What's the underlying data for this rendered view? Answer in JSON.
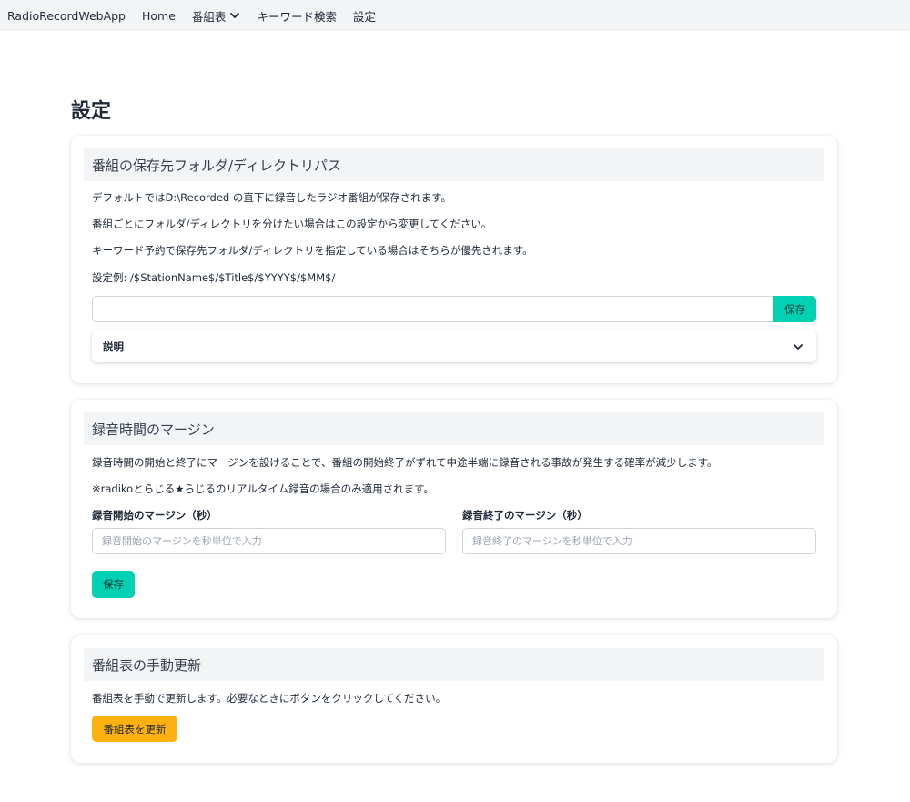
{
  "navbar": {
    "brand": "RadioRecordWebApp",
    "items": [
      {
        "label": "Home"
      },
      {
        "label": "番組表"
      },
      {
        "label": "キーワード検索"
      },
      {
        "label": "設定"
      }
    ]
  },
  "page": {
    "title": "設定"
  },
  "folder_card": {
    "title": "番組の保存先フォルダ/ディレクトリパス",
    "lines": [
      "デフォルトではD:\\Recorded の直下に録音したラジオ番組が保存されます。",
      "番組ごとにフォルダ/ディレクトリを分けたい場合はこの設定から変更してください。",
      "キーワード予約で保存先フォルダ/ディレクトリを指定している場合はそちらが優先されます。",
      "設定例: /$StationName$/$Title$/$YYYY$/$MM$/"
    ],
    "input_value": "",
    "save_label": "保存",
    "collapse_label": "説明"
  },
  "margin_card": {
    "title": "録音時間のマージン",
    "lines": [
      "録音時間の開始と終了にマージンを設けることで、番組の開始終了がずれて中途半端に録音される事故が発生する確率が減少します。",
      "※radikoとらじる★らじるのリアルタイム録音の場合のみ適用されます。"
    ],
    "start_label": "録音開始のマージン（秒）",
    "start_placeholder": "録音開始のマージンを秒単位で入力",
    "end_label": "録音終了のマージン（秒）",
    "end_placeholder": "録音終了のマージンを秒単位で入力",
    "save_label": "保存"
  },
  "update_card": {
    "title": "番組表の手動更新",
    "line": "番組表を手動で更新します。必要なときにボタンをクリックしてください。",
    "button_label": "番組表を更新"
  },
  "colors": {
    "primary": "#00d1b2",
    "warning": "#ffb20f",
    "navbar_bg": "#f3f4f6"
  }
}
